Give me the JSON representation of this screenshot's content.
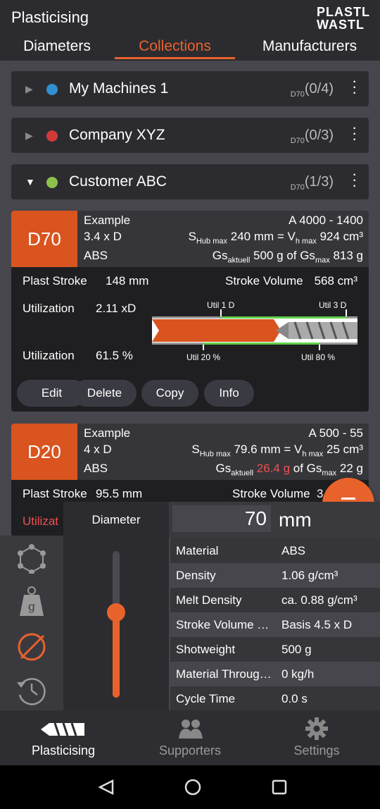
{
  "header": {
    "title": "Plasticising",
    "logo_line1": "PLASTL",
    "logo_line2": "WASTL"
  },
  "tabs": [
    {
      "label": "Diameters"
    },
    {
      "label": "Collections"
    },
    {
      "label": "Manufacturers"
    }
  ],
  "collections": [
    {
      "name": "My Machines 1",
      "dia": "D70",
      "count": "(0/4)",
      "color": "#2f8fd0"
    },
    {
      "name": "Company XYZ",
      "dia": "D70",
      "count": "(0/3)",
      "color": "#d23a3a"
    },
    {
      "name": "Customer ABC",
      "dia": "D70",
      "count": "(1/3)",
      "color": "#8bc34a"
    }
  ],
  "card1": {
    "badge": "D70",
    "name": "Example",
    "ld": "3.4 x D",
    "material": "ABS",
    "machine": "A 4000 - 1400",
    "s_label": "S",
    "s_sub": "Hub max",
    "s_val": "240 mm  =  V",
    "v_sub": "h max",
    "v_val": "924 cm³",
    "gs_label": "Gs",
    "gs_sub": "aktuell",
    "gs_val": "500 g",
    "gs_of": "of Gs",
    "gsmax_sub": "max",
    "gsmax_val": "813 g",
    "plast_stroke_label": "Plast Stroke",
    "plast_stroke": "148 mm",
    "stroke_vol_label": "Stroke Volume",
    "stroke_vol": "568 cm³",
    "util_label": "Utilization",
    "util_d": "2.11 xD",
    "util_pct": "61.5 %",
    "util1d": "Util 1 D",
    "util3d": "Util 3 D",
    "util20": "Util 20 %",
    "util80": "Util 80 %",
    "util_d_fraction": 0.65,
    "util_pct_fraction": 0.615,
    "buttons": [
      "Edit",
      "Delete",
      "Copy",
      "Info"
    ]
  },
  "card2": {
    "badge": "D20",
    "name": "Example",
    "ld": "4 x D",
    "material": "ABS",
    "machine": "A 500 - 55",
    "s_label": "S",
    "s_sub": "Hub max",
    "s_val": "79.6 mm  =  V",
    "v_sub": "h max",
    "v_val": "25 cm³",
    "gs_label": "Gs",
    "gs_sub": "aktuell",
    "gs_val": "26.4 g",
    "gs_of": "of Gs",
    "gsmax_sub": "max",
    "gsmax_val": "22 g",
    "plast_stroke_label": "Plast Stroke",
    "plast_stroke": "95.5 mm",
    "stroke_vol_label": "Stroke Volume",
    "stroke_vol_partial": "3",
    "util_partial": "Utilizat"
  },
  "panel": {
    "diameter_label": "Diameter",
    "diameter_value": "70",
    "unit": "mm",
    "slider_fraction": 0.58,
    "rows": [
      {
        "k": "Material",
        "v": "ABS"
      },
      {
        "k": "Density",
        "v": "1.06 g/cm³"
      },
      {
        "k": "Melt Density",
        "v": "ca. 0.88 g/cm³"
      },
      {
        "k": "Stroke Volume V…",
        "v": "Basis 4.5 x D"
      },
      {
        "k": "Shotweight",
        "v": "500 g"
      },
      {
        "k": "Material Throug…",
        "v": "0 kg/h"
      },
      {
        "k": "Cycle Time",
        "v": "0.0 s"
      }
    ]
  },
  "nav": [
    {
      "label": "Plasticising"
    },
    {
      "label": "Supporters"
    },
    {
      "label": "Settings"
    }
  ],
  "colors": {
    "accent": "#e8622c",
    "warning": "#f05050"
  }
}
